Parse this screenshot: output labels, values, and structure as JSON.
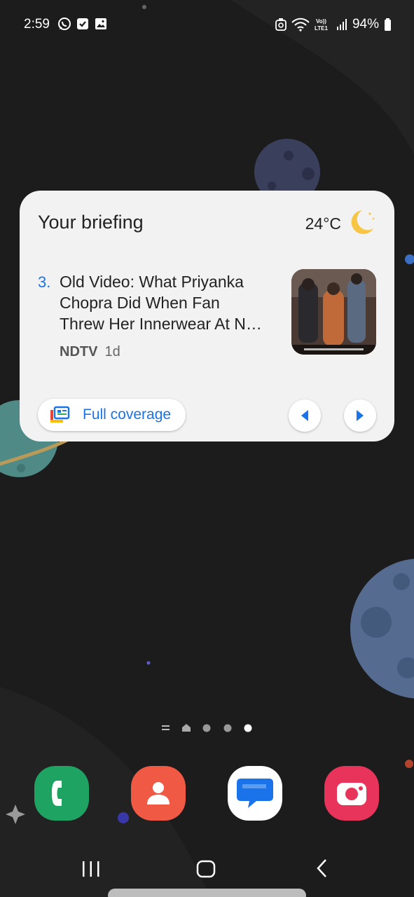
{
  "status_bar": {
    "time": "2:59",
    "battery": "94%",
    "left_icons": [
      "whatsapp-icon",
      "checkbox-notification-icon",
      "gallery-icon"
    ],
    "right_icons": [
      "sync-icon",
      "wifi-icon",
      "volte-lte-icon",
      "signal-icon",
      "battery-icon"
    ]
  },
  "widget": {
    "title": "Your briefing",
    "temperature": "24°C",
    "weather_icon": "moon-icon",
    "story_number": "3.",
    "headline_lines": [
      "Old Video: What Priyanka",
      "Chopra Did When Fan",
      "Threw Her Innerwear At N…"
    ],
    "source": "NDTV",
    "age": "1d",
    "coverage_label": "Full coverage",
    "accent_color": "#1a73e8"
  },
  "page_indicator": {
    "pages": 5,
    "active_page": 5
  },
  "dock": {
    "apps": [
      {
        "name": "Phone",
        "icon": "phone-icon",
        "color": "#1ea362"
      },
      {
        "name": "Contacts",
        "icon": "contacts-icon",
        "color": "#f05a45"
      },
      {
        "name": "Messages",
        "icon": "messages-icon",
        "color": "#ffffff"
      },
      {
        "name": "Camera",
        "icon": "camera-icon",
        "color": "#e8335a"
      }
    ]
  },
  "nav_bar": {
    "buttons": [
      "recents-icon",
      "home-icon",
      "back-icon"
    ]
  }
}
